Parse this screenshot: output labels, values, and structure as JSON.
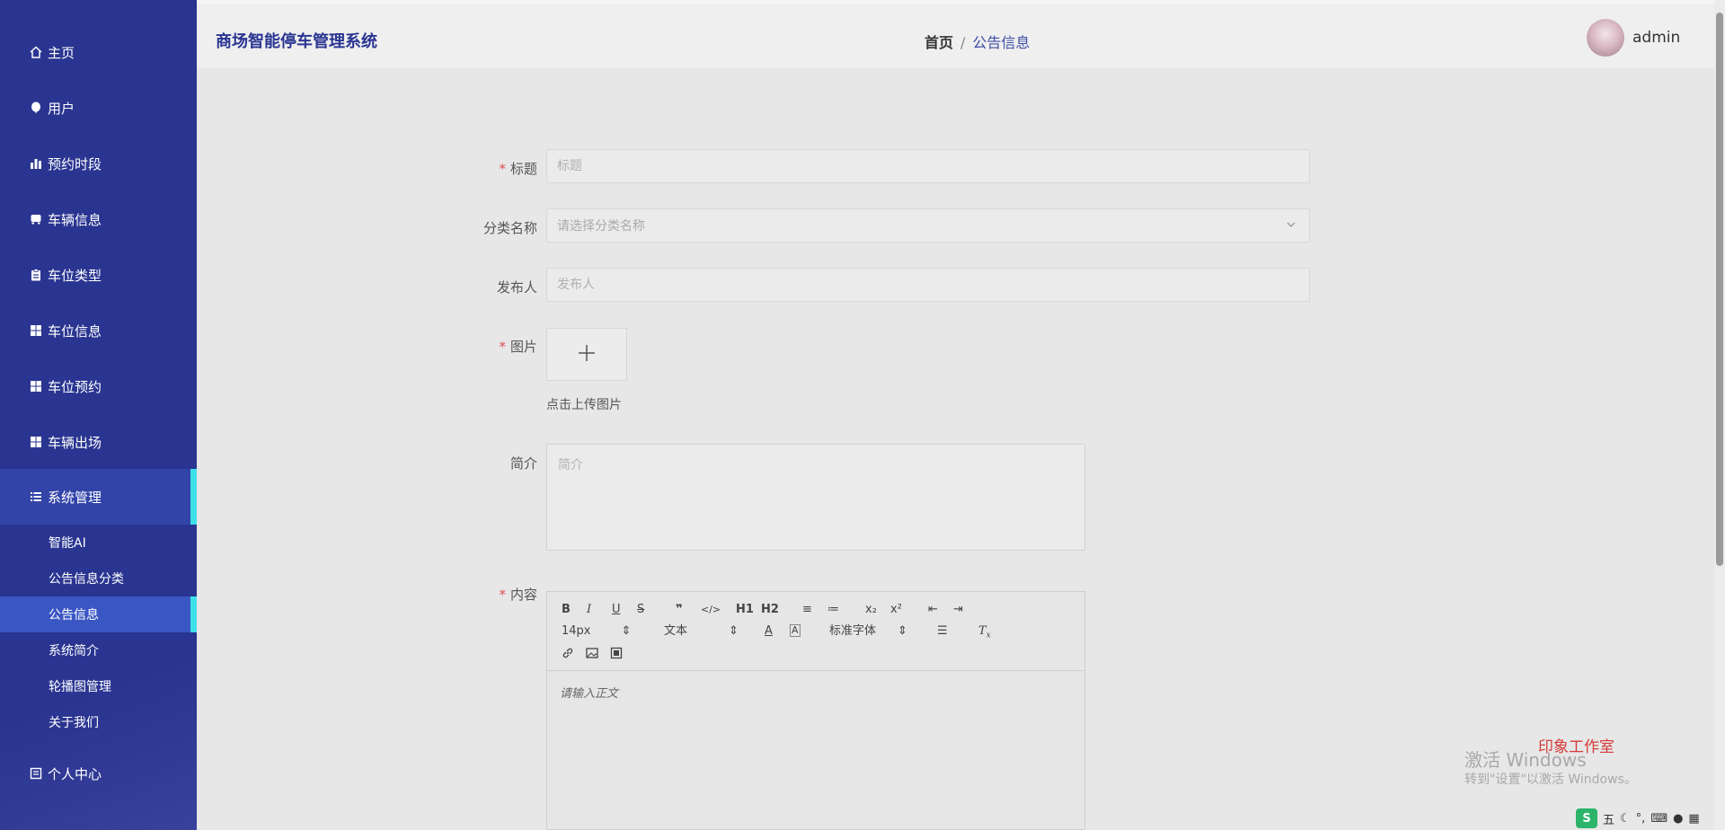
{
  "sidebar": {
    "items": [
      {
        "label": "主页",
        "icon": "home-icon"
      },
      {
        "label": "用户",
        "icon": "balloon-icon"
      },
      {
        "label": "预约时段",
        "icon": "bar-chart-icon"
      },
      {
        "label": "车辆信息",
        "icon": "bus-icon"
      },
      {
        "label": "车位类型",
        "icon": "clipboard-icon"
      },
      {
        "label": "车位信息",
        "icon": "grid-icon"
      },
      {
        "label": "车位预约",
        "icon": "grid-icon"
      },
      {
        "label": "车辆出场",
        "icon": "grid-icon"
      },
      {
        "label": "系统管理",
        "icon": "list-icon"
      }
    ],
    "sub_items": [
      "智能AI",
      "公告信息分类",
      "公告信息",
      "系统简介",
      "轮播图管理",
      "关于我们"
    ],
    "partial_item": "个人中心"
  },
  "header": {
    "app_title": "商场智能停车管理系统",
    "breadcrumb_home": "首页",
    "breadcrumb_sep": "/",
    "breadcrumb_current": "公告信息",
    "username": "admin"
  },
  "form": {
    "title_label": "标题",
    "title_placeholder": "标题",
    "category_label": "分类名称",
    "category_placeholder": "请选择分类名称",
    "publisher_label": "发布人",
    "publisher_placeholder": "发布人",
    "image_label": "图片",
    "upload_tip": "点击上传图片",
    "intro_label": "简介",
    "intro_placeholder": "简介",
    "content_label": "内容",
    "required_mark": "*"
  },
  "editor": {
    "row1": [
      "B",
      "I",
      "U",
      "S",
      "❞",
      "</>",
      "H1",
      "H2",
      "≡",
      "≔",
      "x₂",
      "x²",
      "⇤",
      "⇥"
    ],
    "font_size": "14px",
    "block_type": "文本",
    "font_family": "标准字体",
    "placeholder": "请输入正文"
  },
  "system": {
    "activate_title": "激活 Windows",
    "activate_hint": "转到\"设置\"以激活 Windows。",
    "studio": "印象工作室",
    "ime_label": "S",
    "ime_mode": "五"
  },
  "colors": {
    "sidebar_bg": "#2a3591",
    "active_accent": "#3ee0e8",
    "required": "#e05050"
  }
}
